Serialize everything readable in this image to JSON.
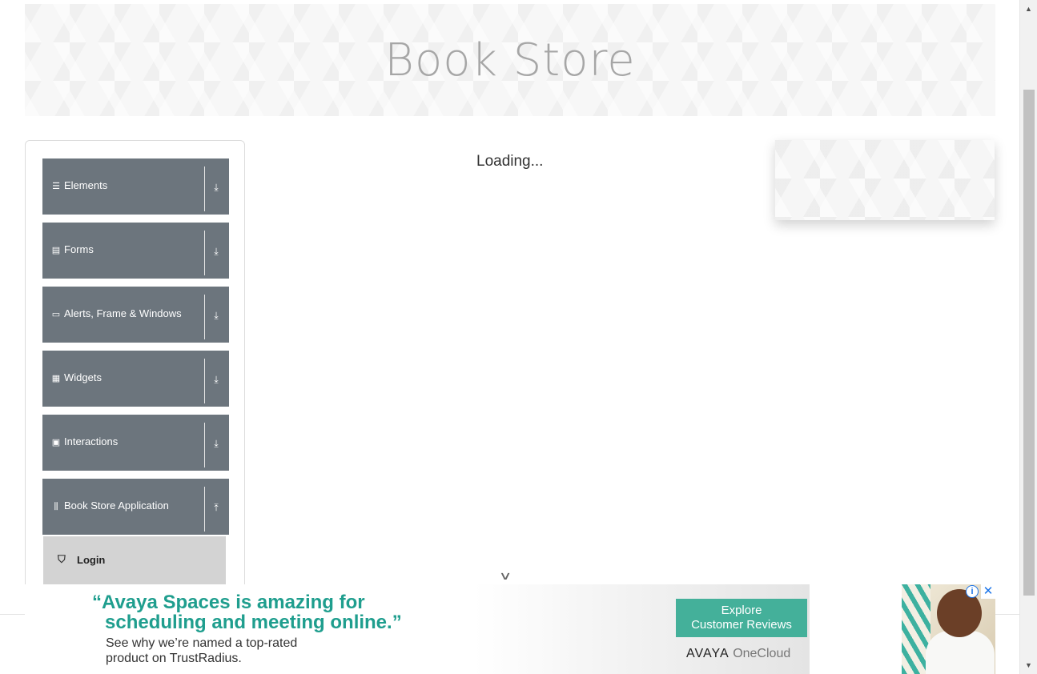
{
  "header": {
    "title": "Book Store"
  },
  "sidebar": {
    "groups": [
      {
        "label": "Elements",
        "icon": "list-icon",
        "toggle": "⤓"
      },
      {
        "label": "Forms",
        "icon": "form-icon",
        "toggle": "⤓"
      },
      {
        "label": "Alerts, Frame & Windows",
        "icon": "window-icon",
        "toggle": "⤓"
      },
      {
        "label": "Widgets",
        "icon": "grid-icon",
        "toggle": "⤓"
      },
      {
        "label": "Interactions",
        "icon": "interaction-icon",
        "toggle": "⤓"
      },
      {
        "label": "Book Store Application",
        "icon": "books-icon",
        "toggle": "⤒"
      }
    ],
    "submenu": {
      "label": "Login",
      "icon": "html5-icon"
    }
  },
  "main": {
    "loading_text": "Loading..."
  },
  "ad": {
    "quote_line1": "“Avaya Spaces is amazing for",
    "quote_line2": "scheduling and meeting online.”",
    "sub_line1": "See why we’re named a top-rated",
    "sub_line2": "product on TrustRadius.",
    "cta_line1": "Explore",
    "cta_line2": "Customer Reviews",
    "brand": "AVAYA",
    "brand_product": "OneCloud",
    "info_glyph": "i",
    "close_glyph": "✕"
  },
  "colors": {
    "sidebar_group_bg": "#6c757d",
    "submenu_bg": "#d3d3d3",
    "ad_accent": "#1f9e8e",
    "cta_bg": "#44b09a"
  }
}
